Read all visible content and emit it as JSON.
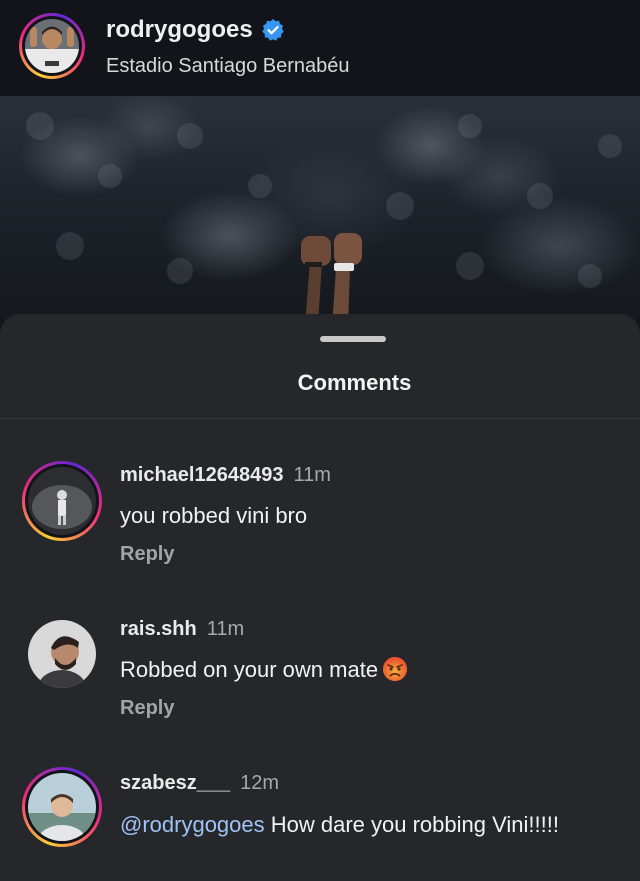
{
  "post": {
    "username": "rodrygogoes",
    "verified_icon": "verified-badge-icon",
    "location": "Estadio Santiago Bernabéu"
  },
  "sheet": {
    "title": "Comments"
  },
  "comments": [
    {
      "username": "michael12648493",
      "time": "11m",
      "text": "you robbed vini bro",
      "reply": "Reply",
      "story_ring": true
    },
    {
      "username": "rais.shh",
      "time": "11m",
      "text": "Robbed on your own mate",
      "emoji": "angry-face-emoji",
      "reply": "Reply",
      "story_ring": false
    },
    {
      "username": "szabesz___",
      "time": "12m",
      "mention": "@rodrygogoes",
      "text": " How dare you robbing Vini!!!!!",
      "story_ring": true
    }
  ],
  "colors": {
    "background": "#101318",
    "sheet": "#26272b",
    "mention": "#9fc3f5",
    "verified": "#3797f0"
  }
}
